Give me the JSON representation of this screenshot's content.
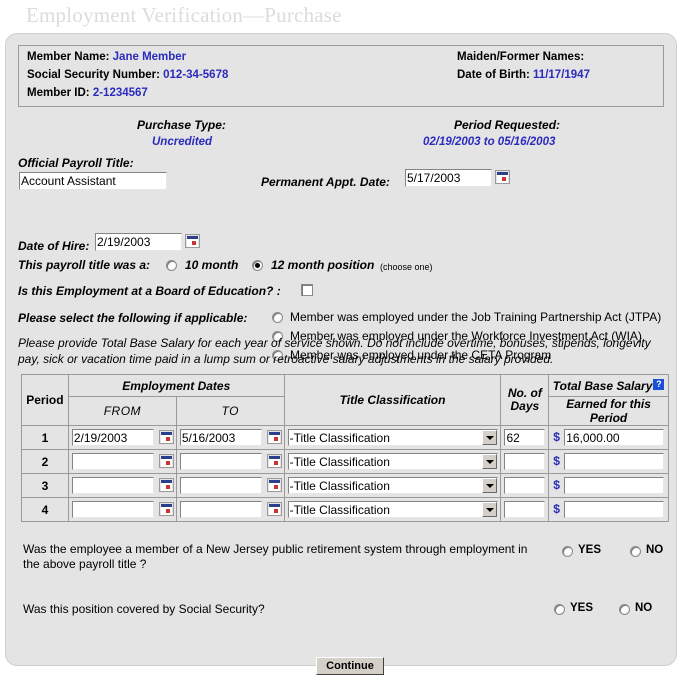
{
  "page": {
    "title": "Employment Verification—Purchase"
  },
  "member_info": {
    "name_label": "Member Name:",
    "name_value": "Jane Member",
    "ssn_label": "Social Security Number:",
    "ssn_value": "012-34-5678",
    "member_id_label": "Member ID:",
    "member_id_value": "2-1234567",
    "maiden_label": "Maiden/Former Names:",
    "maiden_value": "",
    "dob_label": "Date of Birth:",
    "dob_value": "11/17/1947"
  },
  "purchase": {
    "type_label": "Purchase Type:",
    "type_value": "Uncredited",
    "period_label": "Period Requested:",
    "period_value": "02/19/2003 to 05/16/2003"
  },
  "form": {
    "payroll_title_label": "Official Payroll Title:",
    "payroll_title_value": "Account Assistant",
    "permanent_appt_label": "Permanent Appt. Date:",
    "permanent_appt_value": "5/17/2003",
    "date_of_hire_label": "Date of Hire:",
    "date_of_hire_value": "2/19/2003",
    "payroll_type_label": "This payroll title was a:",
    "option_10_month": "10 month",
    "option_12_month": "12 month position",
    "choose_one_note": "(choose one)",
    "boe_label": "Is this Employment at a Board of Education? :",
    "boe_checked": false,
    "select_applicable_label": "Please select the following if applicable:",
    "applicable_options": [
      "Member was employed under the Job Training Partnership Act (JTPA)",
      "Member was employed under the Workforce Investment Act (WIA)",
      "Member was employed under the CETA Program"
    ],
    "instructions": "Please provide Total Base Salary for each year of service shown. Do not include overtime, bonuses, stipends, longevity pay, sick or vacation time paid in a lump sum or retroactive salary adjustments in the salary provided."
  },
  "table": {
    "headers": {
      "period": "Period",
      "employment_dates": "Employment Dates",
      "from": "FROM",
      "to": "TO",
      "title_classification": "Title Classification",
      "no_of_days": "No. of Days",
      "total_base_salary": "Total Base Salary",
      "help_icon": "?",
      "earned_note": "Earned for this Period"
    },
    "select_default": "-Title Classification",
    "currency_symbol": "$",
    "rows": [
      {
        "period": "1",
        "from": "2/19/2003",
        "to": "5/16/2003",
        "classification": "-Title Classification",
        "days": "62",
        "salary": "16,000.00"
      },
      {
        "period": "2",
        "from": "",
        "to": "",
        "classification": "-Title Classification",
        "days": "",
        "salary": ""
      },
      {
        "period": "3",
        "from": "",
        "to": "",
        "classification": "-Title Classification",
        "days": "",
        "salary": ""
      },
      {
        "period": "4",
        "from": "",
        "to": "",
        "classification": "-Title Classification",
        "days": "",
        "salary": ""
      }
    ]
  },
  "questions": {
    "q1": "Was the employee a member of a New Jersey public retirement system through employment in the above payroll title ?",
    "q1_yes": "YES",
    "q1_no": "NO",
    "q2": "Was this position covered by Social Security?",
    "q2_yes": "YES",
    "q2_no": "NO"
  },
  "actions": {
    "continue_label": "Continue"
  },
  "colors": {
    "link_blue": "#2b2bbe",
    "panel_bg": "#e4e4e4",
    "help_blue": "#1c4fd8"
  }
}
